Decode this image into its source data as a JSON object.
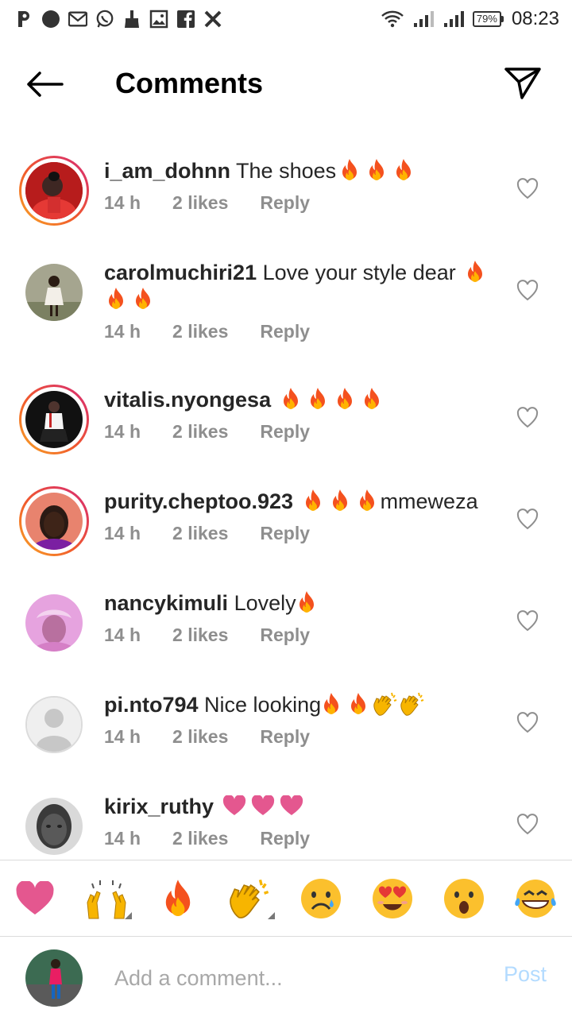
{
  "status_bar": {
    "left_icons": [
      "p-icon",
      "circle-icon",
      "gmail-icon",
      "whatsapp-icon",
      "broom-icon",
      "image-icon",
      "facebook-icon",
      "x-icon"
    ],
    "battery": "79%",
    "time": "08:23"
  },
  "header": {
    "title": "Comments",
    "back_icon": "arrow-left-icon",
    "share_icon": "paper-plane-icon"
  },
  "comments": [
    {
      "username": "i_am_dohnn",
      "text": "The shoes",
      "emojis": [
        "fire",
        "fire",
        "fire"
      ],
      "time": "14 h",
      "likes": "2 likes",
      "reply": "Reply",
      "story_ring": true,
      "avatar_color": "#c62828"
    },
    {
      "username": "carolmuchiri21",
      "text": "Love your style dear",
      "emojis": [
        "fire",
        "fire",
        "fire"
      ],
      "time": "14 h",
      "likes": "2 likes",
      "reply": "Reply",
      "story_ring": false,
      "avatar_color": "#9e9e8e"
    },
    {
      "username": "vitalis.nyongesa",
      "text": "",
      "emojis": [
        "fire",
        "fire",
        "fire",
        "fire"
      ],
      "time": "14 h",
      "likes": "2 likes",
      "reply": "Reply",
      "story_ring": true,
      "avatar_color": "#1a1a1a"
    },
    {
      "username": "purity.cheptoo.923",
      "text": "mmeweza",
      "emojis": [
        "fire",
        "fire",
        "fire"
      ],
      "time": "14 h",
      "likes": "2 likes",
      "reply": "Reply",
      "story_ring": true,
      "avatar_color": "#e07060"
    },
    {
      "username": "nancykimuli",
      "text": "Lovely",
      "emojis": [
        "fire"
      ],
      "time": "14 h",
      "likes": "2 likes",
      "reply": "Reply",
      "story_ring": false,
      "avatar_color": "#d98ad6"
    },
    {
      "username": "pi.nto794",
      "text": "Nice looking",
      "emojis": [
        "fire",
        "fire",
        "clap",
        "clap"
      ],
      "time": "14 h",
      "likes": "2 likes",
      "reply": "Reply",
      "story_ring": false,
      "avatar_color": "#e0e0e0"
    },
    {
      "username": "kirix_ruthy",
      "text": "",
      "emojis": [
        "heart",
        "heart",
        "heart"
      ],
      "time": "14 h",
      "likes": "2 likes",
      "reply": "Reply",
      "story_ring": false,
      "avatar_color": "#555555"
    }
  ],
  "emoji_bar": [
    "red-heart",
    "raising-hands",
    "fire",
    "clapping-hands",
    "sad-face",
    "heart-eyes-face",
    "surprised-face",
    "tears-of-joy-face"
  ],
  "composer": {
    "placeholder": "Add a comment...",
    "post_label": "Post"
  },
  "colors": {
    "story_ring_start": "#f9a825",
    "story_ring_end": "#d62976",
    "meta_gray": "#8e8e8e",
    "post_blue": "#b3dbff",
    "heart_pink": "#e4578f"
  }
}
